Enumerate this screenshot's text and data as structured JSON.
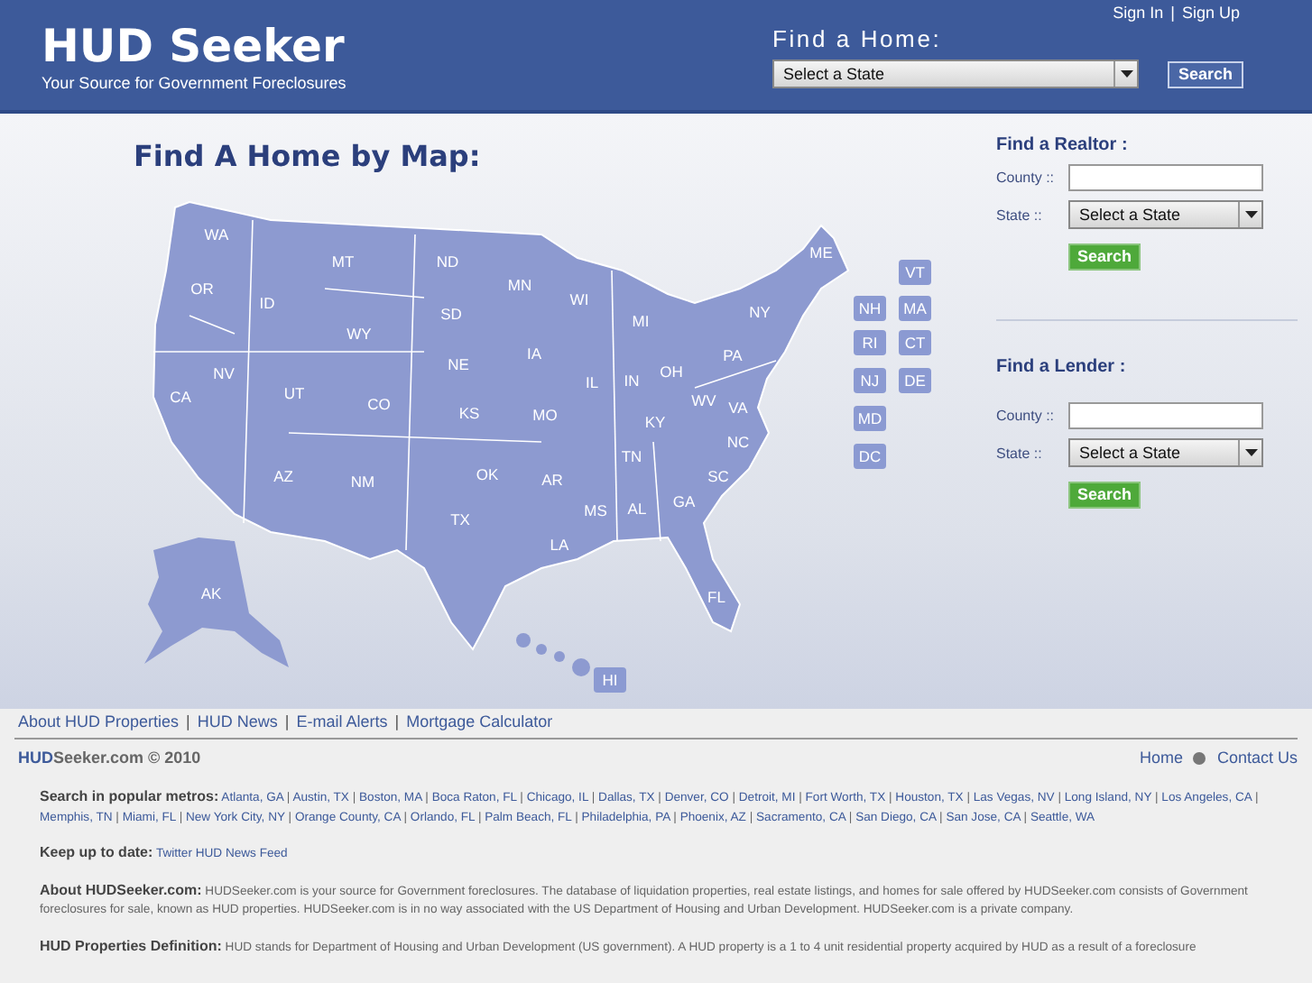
{
  "header": {
    "logo": "HUD Seeker",
    "tagline": "Your Source for Government Foreclosures",
    "top_links": [
      "Sign In",
      "Sign Up"
    ],
    "separator": "|",
    "find_title": "Find a Home:",
    "select": "Select a State",
    "button": "Search"
  },
  "map": {
    "title": "Find A Home by Map:",
    "states": [
      "WA",
      "OR",
      "ID",
      "MT",
      "WY",
      "ND",
      "SD",
      "NE",
      "MN",
      "WI",
      "MI",
      "IA",
      "IL",
      "IN",
      "OH",
      "PA",
      "NY",
      "ME",
      "NV",
      "CA",
      "UT",
      "CO",
      "KS",
      "MO",
      "KY",
      "WV",
      "VA",
      "NC",
      "TN",
      "AR",
      "OK",
      "TX",
      "NM",
      "AZ",
      "LA",
      "MS",
      "AL",
      "GA",
      "SC",
      "FL",
      "AK"
    ],
    "small_states": [
      "VT",
      "NH",
      "MA",
      "RI",
      "CT",
      "NJ",
      "DE",
      "MD",
      "DC",
      "HI"
    ]
  },
  "sidebar": [
    {
      "title": "Find a Realtor :",
      "county_label": "County ::",
      "state_label": "State ::",
      "select": "Select a State",
      "button": "Search"
    },
    {
      "title": "Find a Lender :",
      "county_label": "County ::",
      "state_label": "State ::",
      "select": "Select a State",
      "button": "Search"
    }
  ],
  "footer_links": [
    "About HUD Properties",
    "HUD News",
    "E-mail Alerts",
    "Mortgage Calculator"
  ],
  "copyright": "**HUD**Seeker.com © 2010",
  "footer_right": [
    "Home",
    "Contact Us"
  ],
  "info": {
    "metros_label": "Search in popular metros:",
    "metros": [
      "Atlanta, GA",
      "Austin, TX",
      "Boston, MA",
      "Boca Raton, FL",
      "Chicago, IL",
      "Dallas, TX",
      "Denver, CO",
      "Detroit, MI",
      "Fort Worth, TX",
      "Houston, TX",
      "Las Vegas, NV",
      "Long Island, NY",
      "Los Angeles, CA",
      "Memphis, TN",
      "Miami, FL",
      "New York City, NY",
      "Orange County, CA",
      "Orlando, FL",
      "Palm Beach, FL",
      "Philadelphia, PA",
      "Phoenix, AZ",
      "Sacramento, CA",
      "San Diego, CA",
      "San Jose, CA",
      "Seattle, WA"
    ],
    "keep_label": "Keep up to date:",
    "feed_link": "Twitter HUD News Feed",
    "about_label": "About HUDSeeker.com:",
    "about_text": "HUDSeeker.com is your source for Government foreclosures. The database of liquidation properties, real estate listings, and homes for sale offered by HUDSeeker.com consists of Government foreclosures for sale, known as HUD properties. HUDSeeker.com is in no way associated with the US Department of Housing and Urban Development. HUDSeeker.com is a private company.",
    "definition_label": "HUD Properties Definition:",
    "definition_text": "HUD stands for Department of Housing and Urban Development (US government). A HUD property is a 1 to 4 unit residential property acquired by HUD as a result of a foreclosure"
  }
}
